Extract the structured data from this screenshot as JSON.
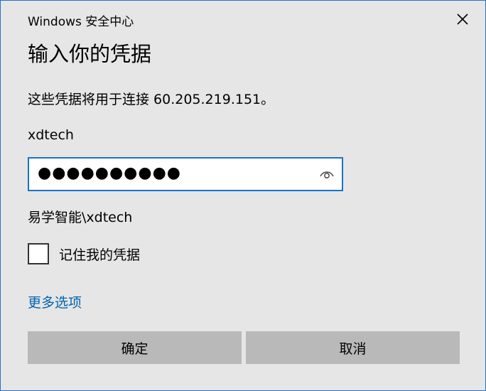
{
  "window": {
    "title": "Windows 安全中心",
    "close_icon": "close-icon"
  },
  "heading": "输入你的凭据",
  "info_text": "这些凭据将用于连接 60.205.219.151。",
  "username": "xdtech",
  "password": {
    "masked_value": "●●●●●●●●●●",
    "reveal_icon": "eye-icon"
  },
  "domain_user": "易学智能\\xdtech",
  "remember": {
    "label": "记住我的凭据",
    "checked": false
  },
  "more_options": "更多选项",
  "buttons": {
    "ok": "确定",
    "cancel": "取消"
  },
  "colors": {
    "accent": "#1a73c7",
    "link": "#0063b1",
    "background": "#e6e6e6",
    "button": "#b9b9b9"
  }
}
